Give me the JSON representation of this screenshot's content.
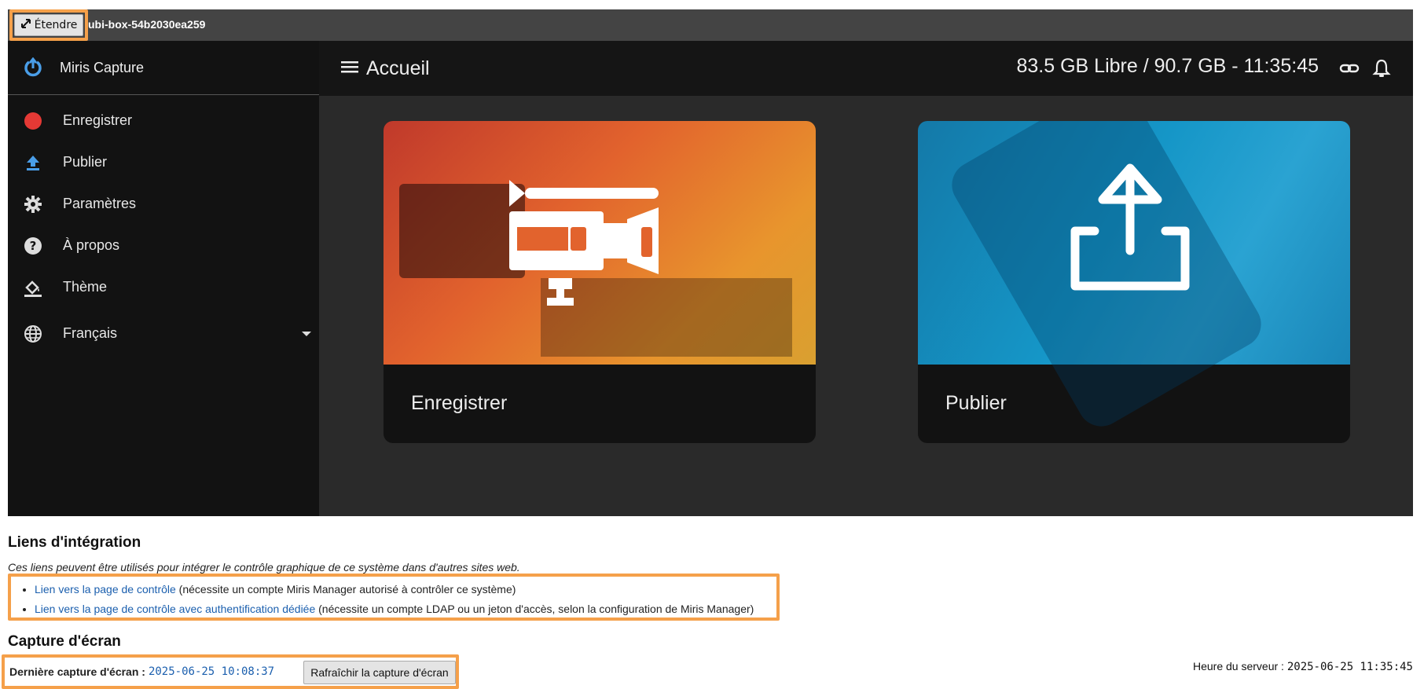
{
  "topbar": {
    "expand_label": "Étendre",
    "box_name": "ubi-box-54b2030ea259"
  },
  "sidebar": {
    "brand": "Miris Capture",
    "items": [
      {
        "label": "Enregistrer"
      },
      {
        "label": "Publier"
      },
      {
        "label": "Paramètres"
      },
      {
        "label": "À propos"
      },
      {
        "label": "Thème"
      }
    ],
    "language": "Français"
  },
  "header": {
    "title": "Accueil",
    "storage": "83.5 GB Libre / 90.7 GB - 11:35:45"
  },
  "cards": [
    {
      "label": "Enregistrer"
    },
    {
      "label": "Publier"
    }
  ],
  "integration": {
    "title": "Liens d'intégration",
    "description": "Ces liens peuvent être utilisés pour intégrer le contrôle graphique de ce système dans d'autres sites web.",
    "links": [
      {
        "text": "Lien vers la page de contrôle",
        "note": " (nécessite un compte Miris Manager autorisé à contrôler ce système)"
      },
      {
        "text": "Lien vers la page de contrôle avec authentification dédiée",
        "note": " (nécessite un compte LDAP ou un jeton d'accès, selon la configuration de Miris Manager)"
      }
    ]
  },
  "screenshot": {
    "title": "Capture d'écran",
    "last_label": "Dernière capture d'écran :",
    "last_value": "2025-06-25 10:08:37",
    "refresh_label": "Rafraîchir la capture d'écran",
    "server_label": "Heure du serveur :",
    "server_value": "2025-06-25 11:35:45"
  },
  "colors": {
    "accent_orange": "#f5a04a",
    "record_red": "#e53935",
    "publish_blue": "#4a9ee8",
    "link_blue": "#1b5fae"
  }
}
